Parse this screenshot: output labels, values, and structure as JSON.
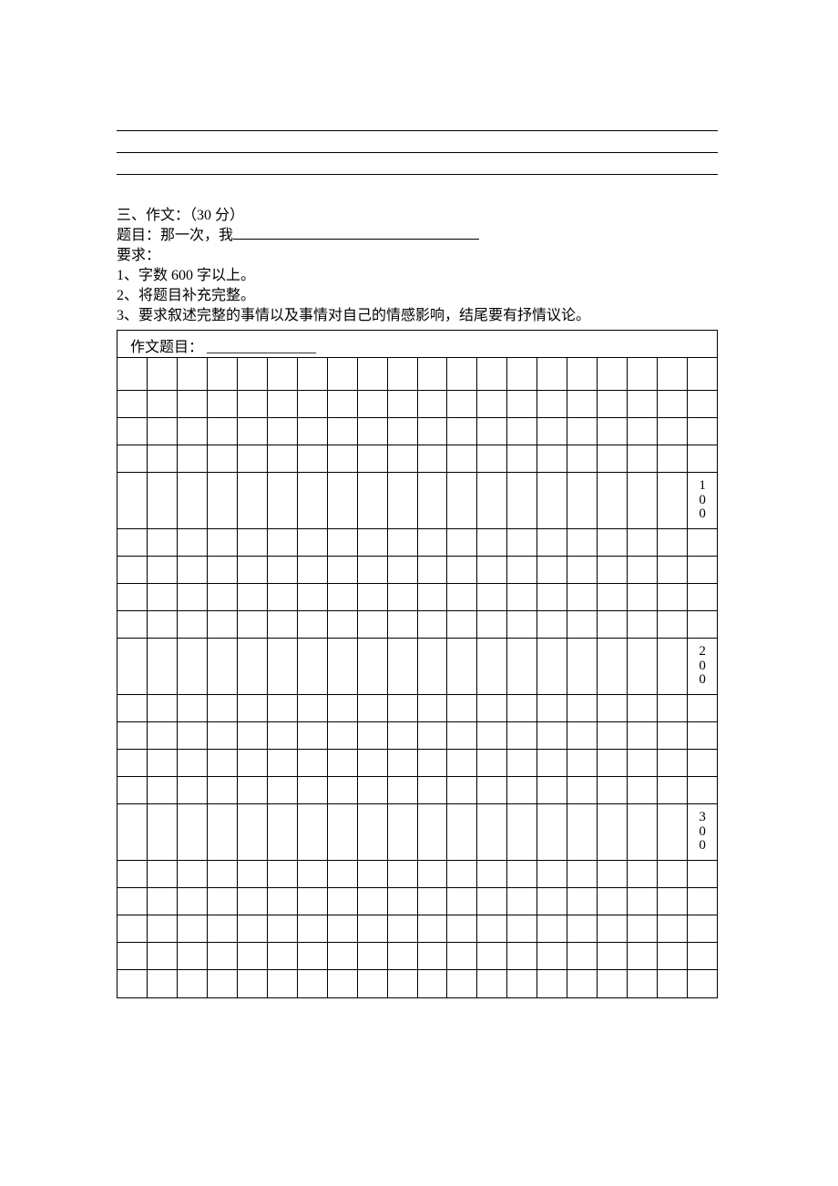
{
  "section_heading": "三、作文：（30 分）",
  "prompt_prefix": "题目：那一次，我",
  "requirements_label": "要求：",
  "req1": "1、字数 600 字以上。",
  "req2": "2、将题目补充完整。",
  "req3": "3、要求叙述完整的事情以及事情对自己的情感影响，结尾要有抒情议论。",
  "grid_title_label": "作文题目：",
  "grid_title_fill": "_______________",
  "milestones": {
    "m100": "1\n0\n0",
    "m200": "2\n0\n0",
    "m300": "3\n0\n0"
  }
}
